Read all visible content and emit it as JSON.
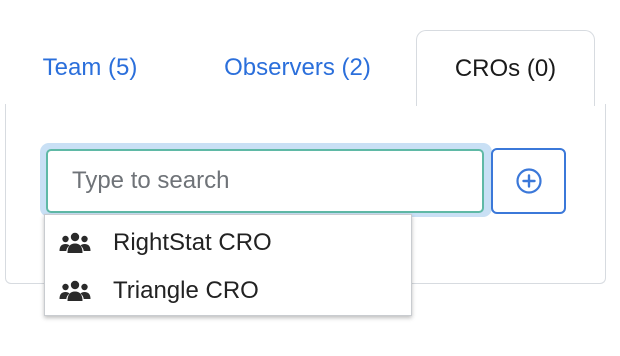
{
  "tabs": [
    {
      "label": "Team (5)",
      "active": false
    },
    {
      "label": "Observers (2)",
      "active": false
    },
    {
      "label": "CROs (0)",
      "active": true
    }
  ],
  "search": {
    "placeholder": "Type to search",
    "value": ""
  },
  "add_button": {
    "icon": "plus-circle-icon"
  },
  "dropdown": {
    "items": [
      {
        "label": "RightStat CRO",
        "icon": "users-icon"
      },
      {
        "label": "Triangle CRO",
        "icon": "users-icon"
      }
    ]
  },
  "colors": {
    "link": "#2b6fdb",
    "focus_border": "#5fb9a6",
    "focus_glow": "#c9e0f5",
    "button_border": "#3b78d9"
  }
}
